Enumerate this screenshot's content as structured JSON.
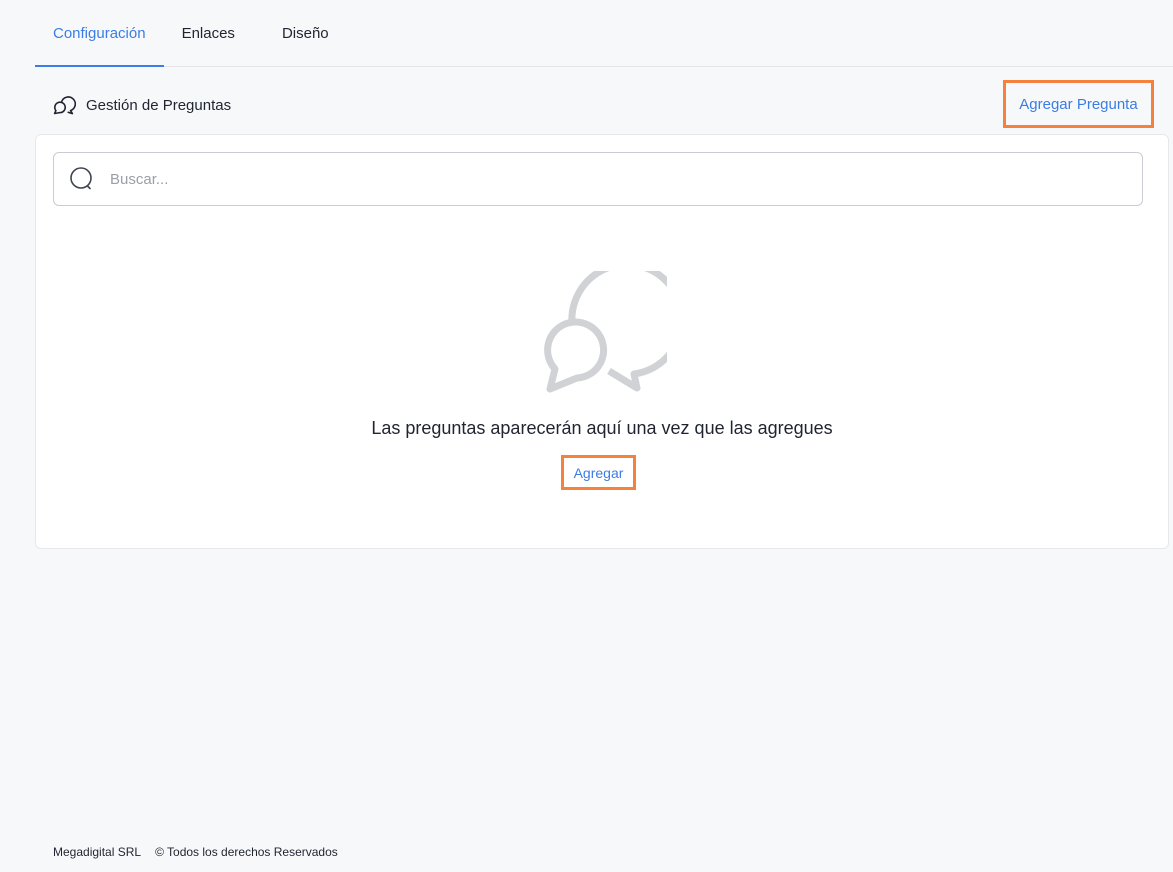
{
  "tabs": [
    {
      "label": "Configuración",
      "active": true
    },
    {
      "label": "Enlaces",
      "active": false
    },
    {
      "label": "Diseño",
      "active": false
    }
  ],
  "section": {
    "icon": "chat-bubbles-icon",
    "title": "Gestión de Preguntas",
    "add_button": "Agregar Pregunta"
  },
  "search": {
    "icon": "search-icon",
    "placeholder": "Buscar..."
  },
  "empty_state": {
    "icon": "chat-bubbles-icon",
    "message": "Las preguntas aparecerán aquí una vez que las agregues",
    "add_button": "Agregar"
  },
  "footer": {
    "company": "Megadigital SRL",
    "copyright": "© Todos los derechos Reservados"
  },
  "colors": {
    "accent": "#3b7de4",
    "highlight": "#f5813c",
    "background": "#f7f8fa",
    "card": "#ffffff"
  }
}
